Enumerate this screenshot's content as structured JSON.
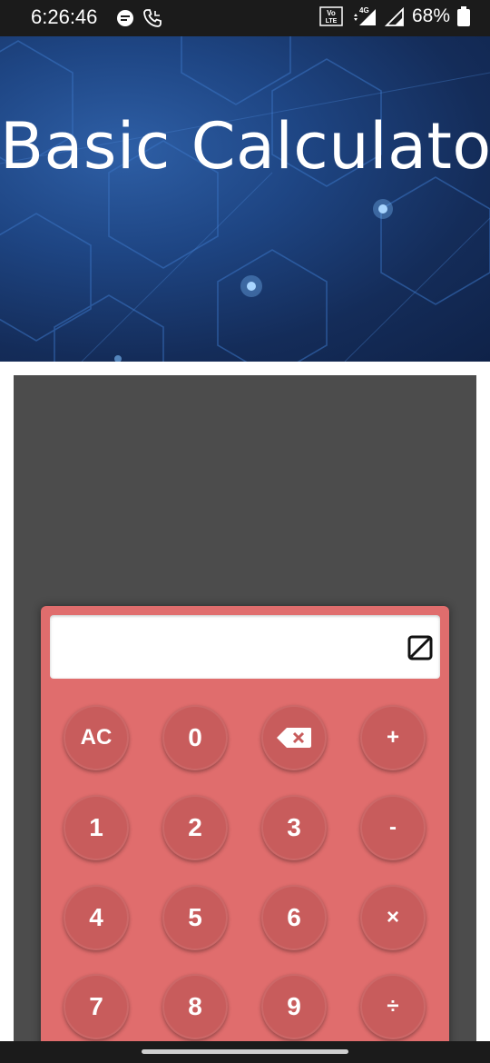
{
  "status_bar": {
    "time": "6:26:46",
    "network_label": "4G",
    "volte_label": "VoLTE",
    "battery": "68%"
  },
  "header": {
    "title": "Basic Calculator"
  },
  "calculator": {
    "display_value": "",
    "keys": [
      [
        "AC",
        "0",
        "backspace",
        "+"
      ],
      [
        "1",
        "2",
        "3",
        "-"
      ],
      [
        "4",
        "5",
        "6",
        "×"
      ],
      [
        "7",
        "8",
        "9",
        "÷"
      ]
    ],
    "key_labels": {
      "ac": "AC",
      "zero": "0",
      "plus": "+",
      "one": "1",
      "two": "2",
      "three": "3",
      "minus": "-",
      "four": "4",
      "five": "5",
      "six": "6",
      "multiply": "×",
      "seven": "7",
      "eight": "8",
      "nine": "9",
      "divide": "÷"
    }
  },
  "colors": {
    "calculator_body": "#e06d6d",
    "key": "#c85c5c",
    "panel": "#4c4c4c",
    "header_dark": "#142c59"
  }
}
